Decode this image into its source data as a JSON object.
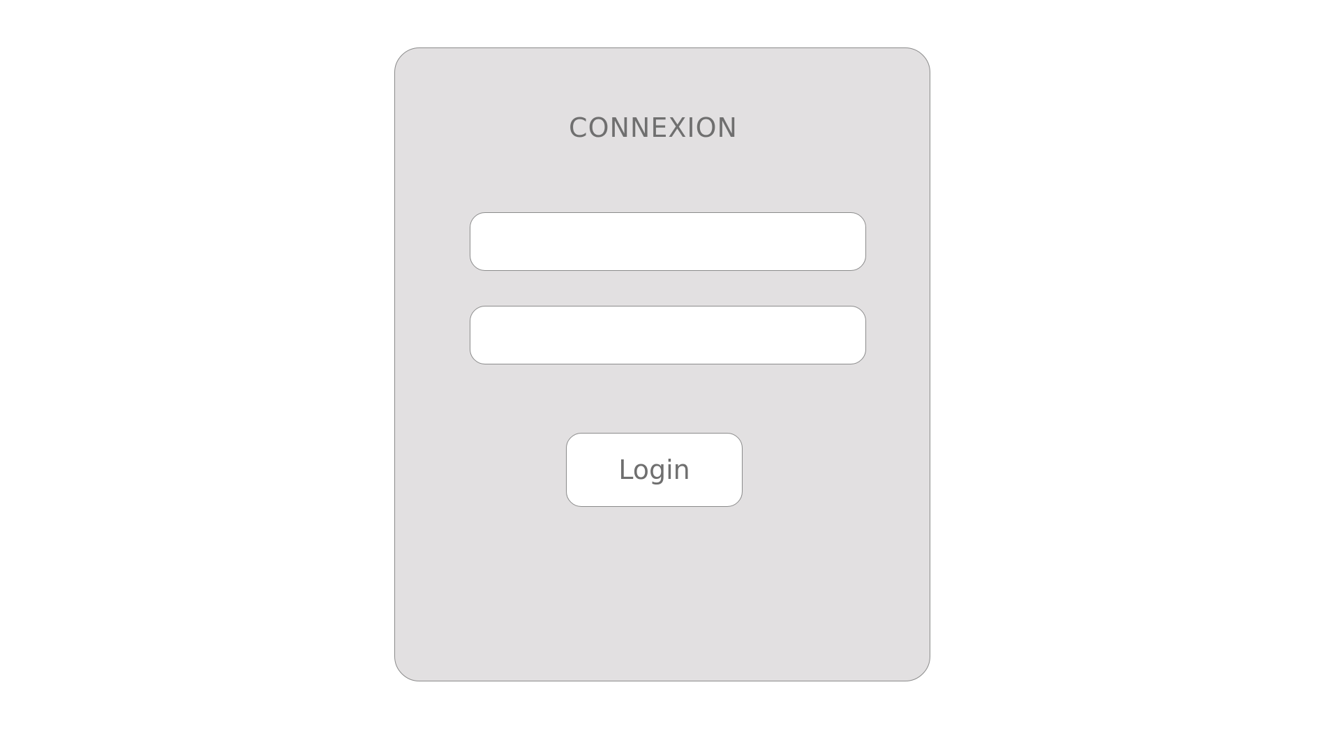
{
  "login_form": {
    "title": "CONNEXION",
    "username": {
      "value": "",
      "placeholder": ""
    },
    "password": {
      "value": "",
      "placeholder": ""
    },
    "submit_label": "Login"
  }
}
